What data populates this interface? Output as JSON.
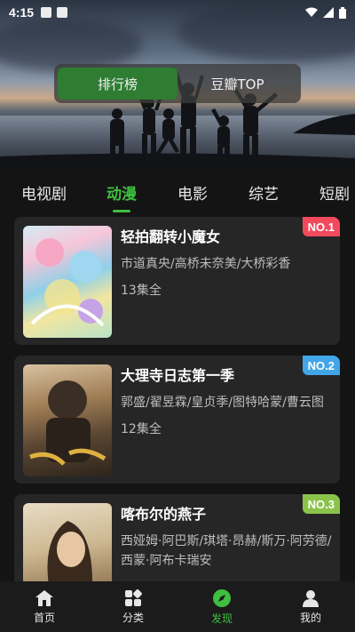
{
  "status_bar": {
    "time": "4:15"
  },
  "hero": {
    "toggle": [
      {
        "label": "排行榜",
        "active": true
      },
      {
        "label": "豆瓣TOP",
        "active": false
      }
    ]
  },
  "tabs": [
    {
      "label": "电视剧",
      "active": false
    },
    {
      "label": "动漫",
      "active": true
    },
    {
      "label": "电影",
      "active": false
    },
    {
      "label": "综艺",
      "active": false
    },
    {
      "label": "短剧",
      "active": false
    }
  ],
  "list": [
    {
      "title": "轻拍翻转小魔女",
      "cast": "市道真央/高桥未奈美/大桥彩香",
      "episodes": "13集全",
      "rank": "NO.1",
      "rank_color": "#f2495c"
    },
    {
      "title": "大理寺日志第一季",
      "cast": "郭盛/翟昱霖/皇贞季/图特哈蒙/曹云图",
      "episodes": "12集全",
      "rank": "NO.2",
      "rank_color": "#42a5e8"
    },
    {
      "title": "喀布尔的燕子",
      "cast": "西娅姆·阿巴斯/琪塔·昂赫/斯万·阿劳德/西蒙·阿布卡瑞安",
      "episodes": "",
      "rank": "NO.3",
      "rank_color": "#8bc34a"
    }
  ],
  "bottom_nav": [
    {
      "label": "首页",
      "icon": "home-icon",
      "active": false
    },
    {
      "label": "分类",
      "icon": "category-icon",
      "active": false
    },
    {
      "label": "发现",
      "icon": "compass-icon",
      "active": true
    },
    {
      "label": "我的",
      "icon": "user-icon",
      "active": false
    }
  ],
  "colors": {
    "accent": "#3fbf3f",
    "background": "#141414",
    "card": "#262626"
  }
}
